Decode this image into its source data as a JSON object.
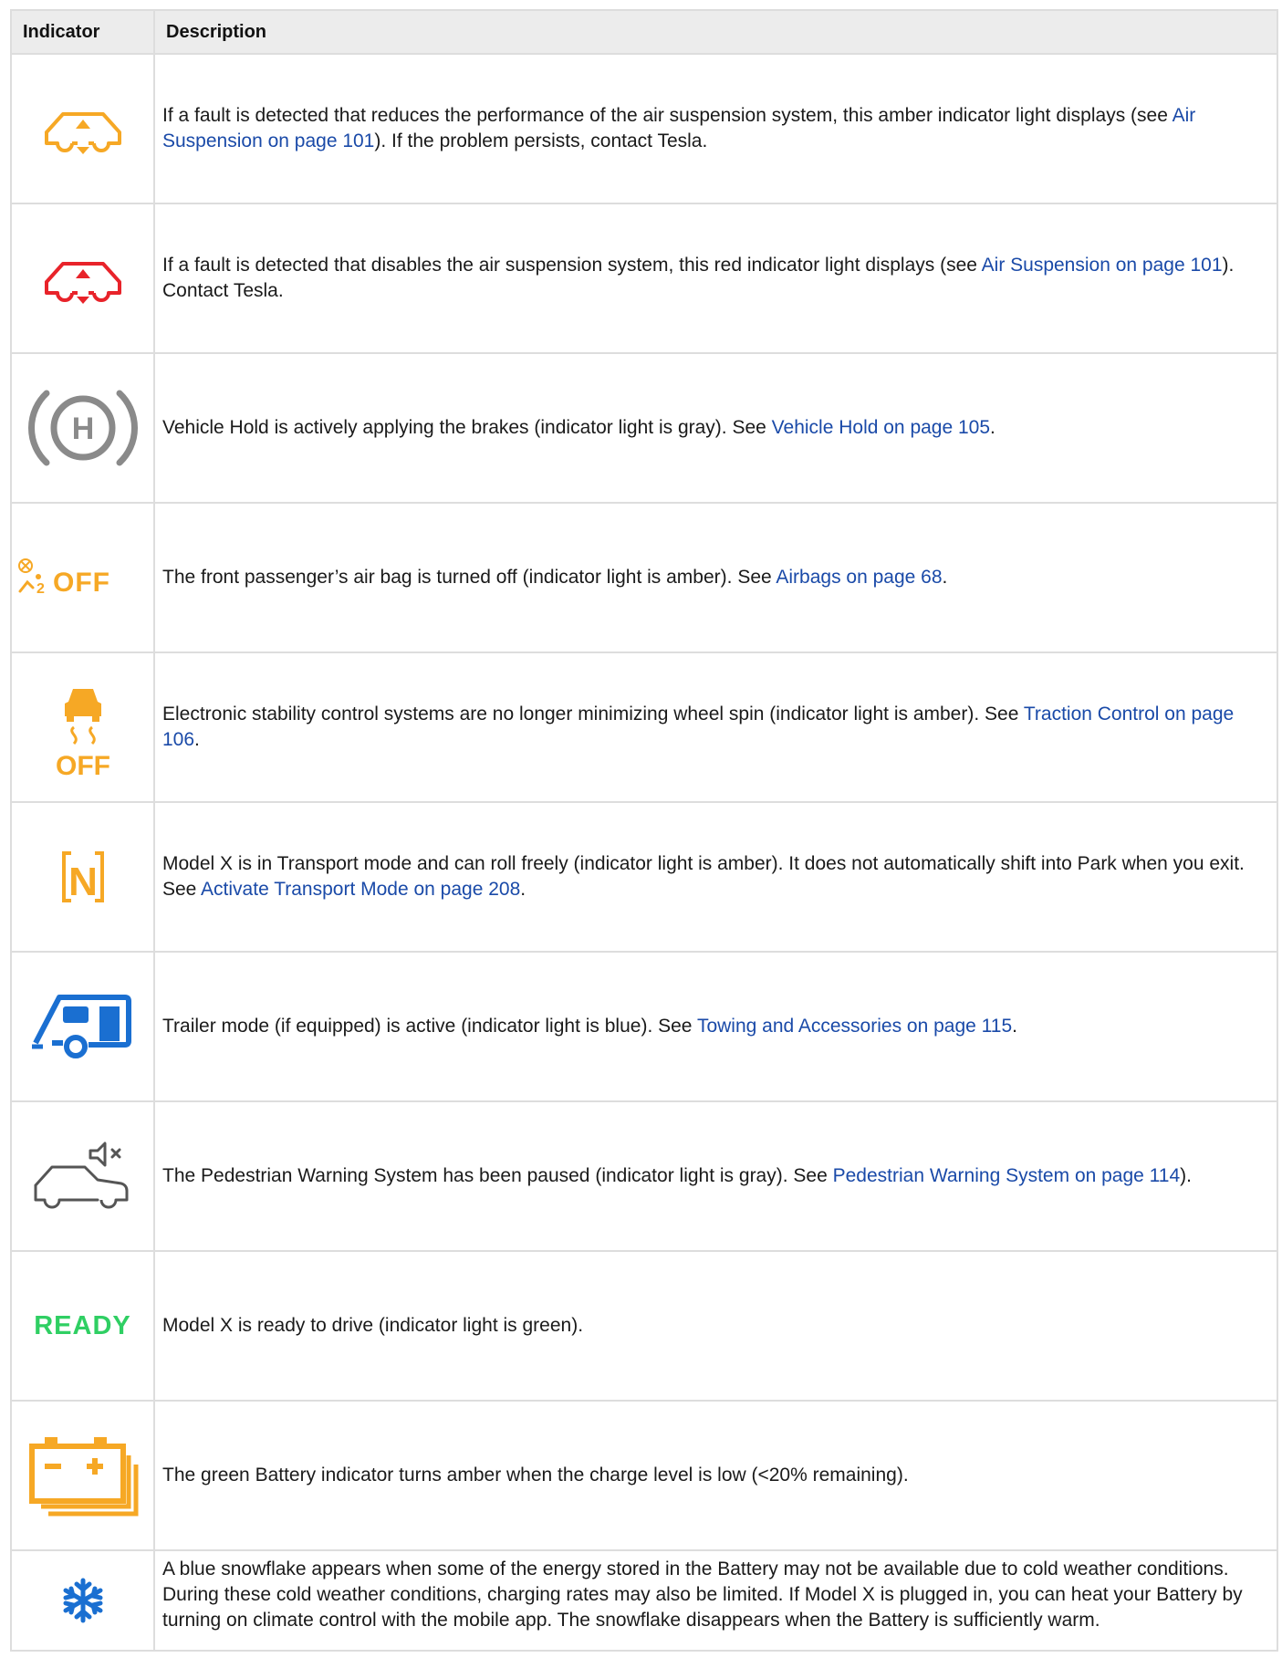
{
  "header": {
    "col1": "Indicator",
    "col2": "Description"
  },
  "colors": {
    "amber": "#f6a825",
    "red": "#e8232a",
    "gray": "#8a8a8a",
    "blue": "#1a6fd1",
    "green": "#2fcf63",
    "link": "#1a4aa8",
    "border": "#dddddd",
    "header_bg": "#ececec"
  },
  "rows": [
    {
      "icon": "air-suspension-amber-icon",
      "pre": "If a fault is detected that reduces the performance of the air suspension system, this amber indicator light displays (see ",
      "link": "Air Suspension on page 101",
      "post": "). If the problem persists, contact Tesla."
    },
    {
      "icon": "air-suspension-red-icon",
      "pre": "If a fault is detected that disables the air suspension system, this red indicator light displays (see ",
      "link": "Air Suspension on page 101",
      "post": "). Contact Tesla."
    },
    {
      "icon": "vehicle-hold-icon",
      "icon_text": "H",
      "pre": "Vehicle Hold is actively applying the brakes (indicator light is gray). See ",
      "link": "Vehicle Hold on page 105",
      "post": "."
    },
    {
      "icon": "passenger-airbag-off-icon",
      "icon_text": "OFF",
      "pre": "The front passenger’s air bag is turned off (indicator light is amber). See ",
      "link": "Airbags on page 68",
      "post": "."
    },
    {
      "icon": "traction-control-off-icon",
      "icon_text": "OFF",
      "pre": "Electronic stability control systems are no longer minimizing wheel spin (indicator light is amber). See ",
      "link": "Traction Control on page 106",
      "post": "."
    },
    {
      "icon": "transport-mode-icon",
      "icon_text": "N",
      "pre": "Model X is in Transport mode and can roll freely (indicator light is amber). It does not automatically shift into Park when you exit. See ",
      "link": "Activate Transport Mode on page 208",
      "post": "."
    },
    {
      "icon": "trailer-mode-icon",
      "pre": "Trailer mode (if equipped) is active (indicator light is blue). See ",
      "link": "Towing and Accessories on page 115",
      "post": "."
    },
    {
      "icon": "pedestrian-warning-paused-icon",
      "pre": "The Pedestrian Warning System has been paused (indicator light is gray). See ",
      "link": "Pedestrian Warning System on page 114",
      "post": ")."
    },
    {
      "icon": "ready-icon",
      "icon_text": "READY",
      "pre": "Model X is ready to drive (indicator light is green).",
      "link": "",
      "post": ""
    },
    {
      "icon": "battery-low-icon",
      "pre": "The green Battery indicator turns amber when the charge level is low (<20% remaining).",
      "link": "",
      "post": ""
    },
    {
      "icon": "snowflake-icon",
      "pre": "A blue snowflake appears when some of the energy stored in the Battery may not be available due to cold weather conditions. During these cold weather conditions, charging rates may also be limited. If Model X is plugged in, you can heat your Battery by turning on climate control with the mobile app. The snowflake disappears when the Battery is sufficiently warm.",
      "link": "",
      "post": ""
    }
  ]
}
